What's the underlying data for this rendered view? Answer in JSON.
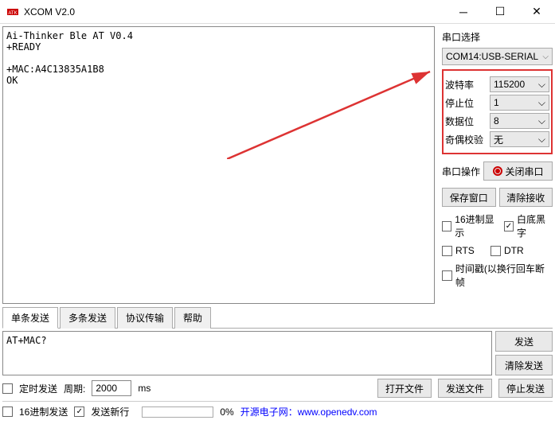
{
  "titlebar": {
    "title": "XCOM V2.0"
  },
  "output": "Ai-Thinker Ble AT V0.4\n+READY\n\n+MAC:A4C13835A1B8\nOK",
  "sidebar": {
    "port_label": "串口选择",
    "port_value": "COM14:USB-SERIAL",
    "baud_label": "波特率",
    "baud_value": "115200",
    "stop_label": "停止位",
    "stop_value": "1",
    "data_label": "数据位",
    "data_value": "8",
    "parity_label": "奇偶校验",
    "parity_value": "无",
    "op_label": "串口操作",
    "op_button": "关闭串口",
    "save_window": "保存窗口",
    "clear_recv": "清除接收",
    "hex_display": "16进制显示",
    "white_black": "白底黑字",
    "rts": "RTS",
    "dtr": "DTR",
    "timestamp": "时间戳(以换行回车断帧"
  },
  "tabs": {
    "single": "单条发送",
    "multi": "多条发送",
    "protocol": "协议传输",
    "help": "帮助"
  },
  "send": {
    "input": "AT+MAC?",
    "send_btn": "发送",
    "clear_btn": "清除发送"
  },
  "bottom": {
    "timed_send": "定时发送",
    "period_label": "周期:",
    "period_value": "2000",
    "period_unit": "ms",
    "open_file": "打开文件",
    "send_file": "发送文件",
    "stop_send": "停止发送",
    "hex_send": "16进制发送",
    "send_newline": "发送新行",
    "progress_pct": "0%",
    "link_text": "开源电子网：www.openedv.com"
  }
}
